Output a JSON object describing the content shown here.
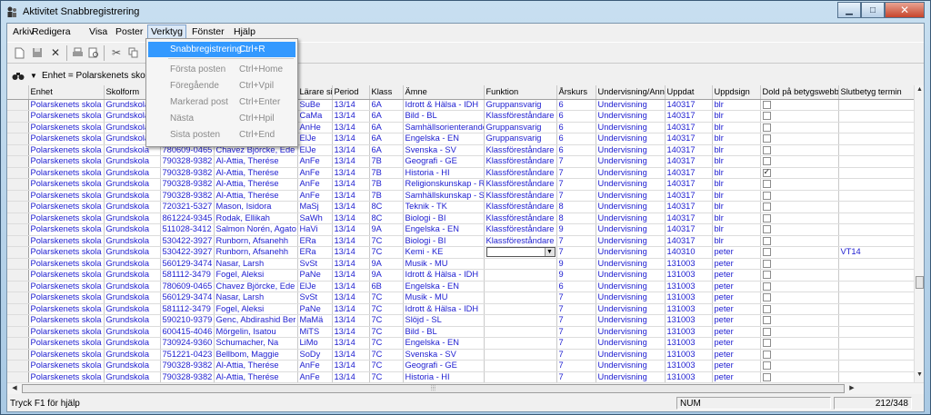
{
  "window": {
    "title": "Aktivitet Snabbregistrering"
  },
  "menubar": [
    "Arkiv",
    "Redigera",
    "Visa",
    "Poster",
    "Verktyg",
    "Fönster",
    "Hjälp"
  ],
  "dropdown": [
    {
      "label": "Snabbregistrering...",
      "shortcut": "Ctrl+R",
      "enabled": true
    },
    {
      "label": "Första posten",
      "shortcut": "Ctrl+Home",
      "enabled": false
    },
    {
      "label": "Föregående",
      "shortcut": "Ctrl+Vpil",
      "enabled": false
    },
    {
      "label": "Markerad post",
      "shortcut": "Ctrl+Enter",
      "enabled": false
    },
    {
      "label": "Nästa",
      "shortcut": "Ctrl+Hpil",
      "enabled": false
    },
    {
      "label": "Sista posten",
      "shortcut": "Ctrl+End",
      "enabled": false
    }
  ],
  "filter": {
    "label": "Enhet = Polarskenets skola"
  },
  "columns": [
    "Enhet",
    "Skolform",
    "",
    "",
    "Lärare si",
    "Period",
    "Klass",
    "Ämne",
    "Funktion",
    "Årskurs",
    "Undervisning/Ann",
    "Uppdat",
    "Uppdsign",
    "Dold på betygswebb",
    "Slutbetyg termin"
  ],
  "rows": [
    [
      "Polarskenets skola",
      "Grundskola",
      "",
      "",
      "SuBe",
      "13/14",
      "6A",
      "Idrott & Hälsa - IDH",
      "Gruppansvarig",
      "6",
      "Undervisning",
      "140317",
      "blr",
      false,
      ""
    ],
    [
      "Polarskenets skola",
      "Grundskola",
      "",
      "",
      "CaMa",
      "13/14",
      "6A",
      "Bild - BL",
      "Klassföreståndare",
      "6",
      "Undervisning",
      "140317",
      "blr",
      false,
      ""
    ],
    [
      "Polarskenets skola",
      "Grundskola",
      "",
      "",
      "AnHe",
      "13/14",
      "6A",
      "Samhällsorienterande",
      "Gruppansvarig",
      "6",
      "Undervisning",
      "140317",
      "blr",
      false,
      ""
    ],
    [
      "Polarskenets skola",
      "Grundskola",
      "",
      "",
      "ElJe",
      "13/14",
      "6A",
      "Engelska - EN",
      "Gruppansvarig",
      "6",
      "Undervisning",
      "140317",
      "blr",
      false,
      ""
    ],
    [
      "Polarskenets skola",
      "Grundskola",
      "780609-0465",
      "Chavez Björcke, Ede",
      "ElJe",
      "13/14",
      "6A",
      "Svenska - SV",
      "Klassföreståndare",
      "6",
      "Undervisning",
      "140317",
      "blr",
      false,
      ""
    ],
    [
      "Polarskenets skola",
      "Grundskola",
      "790328-9382",
      "Al-Attia, Therése",
      "AnFe",
      "13/14",
      "7B",
      "Geografi - GE",
      "Klassföreståndare",
      "7",
      "Undervisning",
      "140317",
      "blr",
      false,
      ""
    ],
    [
      "Polarskenets skola",
      "Grundskola",
      "790328-9382",
      "Al-Attia, Therése",
      "AnFe",
      "13/14",
      "7B",
      "Historia - HI",
      "Klassföreståndare",
      "7",
      "Undervisning",
      "140317",
      "blr",
      true,
      ""
    ],
    [
      "Polarskenets skola",
      "Grundskola",
      "790328-9382",
      "Al-Attia, Therése",
      "AnFe",
      "13/14",
      "7B",
      "Religionskunskap - R",
      "Klassföreståndare",
      "7",
      "Undervisning",
      "140317",
      "blr",
      false,
      ""
    ],
    [
      "Polarskenets skola",
      "Grundskola",
      "790328-9382",
      "Al-Attia, Therése",
      "AnFe",
      "13/14",
      "7B",
      "Samhällskunskap - S",
      "Klassföreståndare",
      "7",
      "Undervisning",
      "140317",
      "blr",
      false,
      ""
    ],
    [
      "Polarskenets skola",
      "Grundskola",
      "720321-5327",
      "Mason, Isidora",
      "MaSj",
      "13/14",
      "8C",
      "Teknik - TK",
      "Klassföreståndare",
      "8",
      "Undervisning",
      "140317",
      "blr",
      false,
      ""
    ],
    [
      "Polarskenets skola",
      "Grundskola",
      "861224-9345",
      "Rodak, Ellikah",
      "SaWh",
      "13/14",
      "8C",
      "Biologi - BI",
      "Klassföreståndare",
      "8",
      "Undervisning",
      "140317",
      "blr",
      false,
      ""
    ],
    [
      "Polarskenets skola",
      "Grundskola",
      "511028-3412",
      "Salmon Norén, Agato",
      "HaVi",
      "13/14",
      "9A",
      "Engelska - EN",
      "Klassföreståndare",
      "9",
      "Undervisning",
      "140317",
      "blr",
      false,
      ""
    ],
    [
      "Polarskenets skola",
      "Grundskola",
      "530422-3927",
      "Runborn, Afsanehh",
      "ERa",
      "13/14",
      "7C",
      "Biologi - BI",
      "Klassföreståndare",
      "7",
      "Undervisning",
      "140317",
      "blr",
      false,
      ""
    ],
    [
      "Polarskenets skola",
      "Grundskola",
      "530422-3927",
      "Runborn, Afsanehh",
      "ERa",
      "13/14",
      "7C",
      "Kemi - KE",
      "",
      "7",
      "Undervisning",
      "140310",
      "peter",
      false,
      "VT14"
    ],
    [
      "Polarskenets skola",
      "Grundskola",
      "560129-3474",
      "Nasar, Larsh",
      "SvSt",
      "13/14",
      "9A",
      "Musik - MU",
      "",
      "9",
      "Undervisning",
      "131003",
      "peter",
      false,
      ""
    ],
    [
      "Polarskenets skola",
      "Grundskola",
      "581112-3479",
      "Fogel, Aleksi",
      "PaNe",
      "13/14",
      "9A",
      "Idrott & Hälsa - IDH",
      "",
      "9",
      "Undervisning",
      "131003",
      "peter",
      false,
      ""
    ],
    [
      "Polarskenets skola",
      "Grundskola",
      "780609-0465",
      "Chavez Björcke, Ede",
      "ElJe",
      "13/14",
      "6B",
      "Engelska - EN",
      "",
      "6",
      "Undervisning",
      "131003",
      "peter",
      false,
      ""
    ],
    [
      "Polarskenets skola",
      "Grundskola",
      "560129-3474",
      "Nasar, Larsh",
      "SvSt",
      "13/14",
      "7C",
      "Musik - MU",
      "",
      "7",
      "Undervisning",
      "131003",
      "peter",
      false,
      ""
    ],
    [
      "Polarskenets skola",
      "Grundskola",
      "581112-3479",
      "Fogel, Aleksi",
      "PaNe",
      "13/14",
      "7C",
      "Idrott & Hälsa - IDH",
      "",
      "7",
      "Undervisning",
      "131003",
      "peter",
      false,
      ""
    ],
    [
      "Polarskenets skola",
      "Grundskola",
      "590210-9379",
      "Genc, Abdirashid Ber",
      "MaMä",
      "13/14",
      "7C",
      "Slöjd - SL",
      "",
      "7",
      "Undervisning",
      "131003",
      "peter",
      false,
      ""
    ],
    [
      "Polarskenets skola",
      "Grundskola",
      "600415-4046",
      "Mörgelin, Isatou",
      "MiTS",
      "13/14",
      "7C",
      "Bild - BL",
      "",
      "7",
      "Undervisning",
      "131003",
      "peter",
      false,
      ""
    ],
    [
      "Polarskenets skola",
      "Grundskola",
      "730924-9360",
      "Schumacher, Na",
      "LiMo",
      "13/14",
      "7C",
      "Engelska - EN",
      "",
      "7",
      "Undervisning",
      "131003",
      "peter",
      false,
      ""
    ],
    [
      "Polarskenets skola",
      "Grundskola",
      "751221-0423",
      "Bellbom, Maggie",
      "SoDy",
      "13/14",
      "7C",
      "Svenska - SV",
      "",
      "7",
      "Undervisning",
      "131003",
      "peter",
      false,
      ""
    ],
    [
      "Polarskenets skola",
      "Grundskola",
      "790328-9382",
      "Al-Attia, Therése",
      "AnFe",
      "13/14",
      "7C",
      "Geografi - GE",
      "",
      "7",
      "Undervisning",
      "131003",
      "peter",
      false,
      ""
    ],
    [
      "Polarskenets skola",
      "Grundskola",
      "790328-9382",
      "Al-Attia, Therése",
      "AnFe",
      "13/14",
      "7C",
      "Historia - HI",
      "",
      "7",
      "Undervisning",
      "131003",
      "peter",
      false,
      ""
    ]
  ],
  "combo_row": 13,
  "statusbar": {
    "help": "Tryck F1 för hjälp",
    "num": "NUM",
    "records": "212/348"
  },
  "icons": [
    "binoculars-icon",
    "new-icon",
    "save-icon",
    "delete-icon",
    "print-icon",
    "print-preview-icon",
    "cut-icon",
    "copy-icon"
  ]
}
